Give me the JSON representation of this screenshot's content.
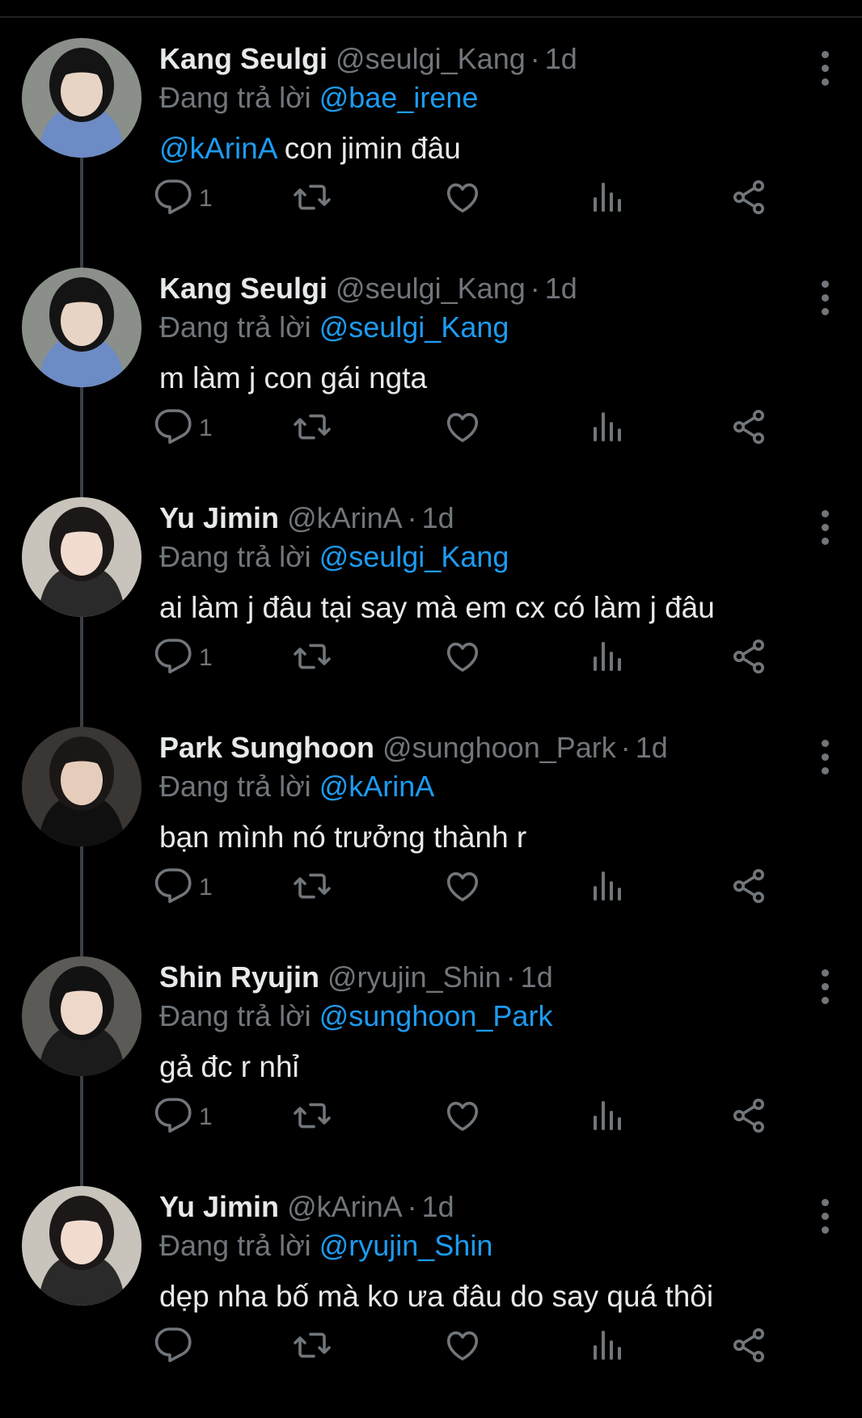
{
  "colors": {
    "background": "#000000",
    "text": "#e7e9ea",
    "muted": "#71767b",
    "accent": "#1d9bf0"
  },
  "icons": {
    "reply": "reply-icon",
    "retweet": "retweet-icon",
    "like": "heart-icon",
    "views": "views-icon",
    "share": "share-icon",
    "more": "more-icon"
  },
  "reply_prefix": "Đang trả lời",
  "tweets": [
    {
      "name": "Kang Seulgi",
      "handle": "@seulgi_Kang",
      "time": "1d",
      "replying_to": "@bae_irene",
      "mention": "@kArinA",
      "text": " con jimin đâu",
      "reply_count": "1"
    },
    {
      "name": "Kang Seulgi",
      "handle": "@seulgi_Kang",
      "time": "1d",
      "replying_to": "@seulgi_Kang",
      "mention": "",
      "text": "m làm j con gái ngta",
      "reply_count": "1"
    },
    {
      "name": "Yu Jimin",
      "handle": "@kArinA",
      "time": "1d",
      "replying_to": "@seulgi_Kang",
      "mention": "",
      "text": "ai làm j đâu tại say mà em cx có làm j đâu",
      "reply_count": "1"
    },
    {
      "name": "Park Sunghoon",
      "handle": "@sunghoon_Park",
      "time": "1d",
      "replying_to": "@kArinA",
      "mention": "",
      "text": "bạn mình nó trưởng thành r",
      "reply_count": "1"
    },
    {
      "name": "Shin Ryujin",
      "handle": "@ryujin_Shin",
      "time": "1d",
      "replying_to": "@sunghoon_Park",
      "mention": "",
      "text": "gả đc r nhỉ",
      "reply_count": "1"
    },
    {
      "name": "Yu Jimin",
      "handle": "@kArinA",
      "time": "1d",
      "replying_to": "@ryujin_Shin",
      "mention": "",
      "text": "dẹp nha bố mà ko ưa đâu do say quá thôi",
      "reply_count": ""
    }
  ]
}
